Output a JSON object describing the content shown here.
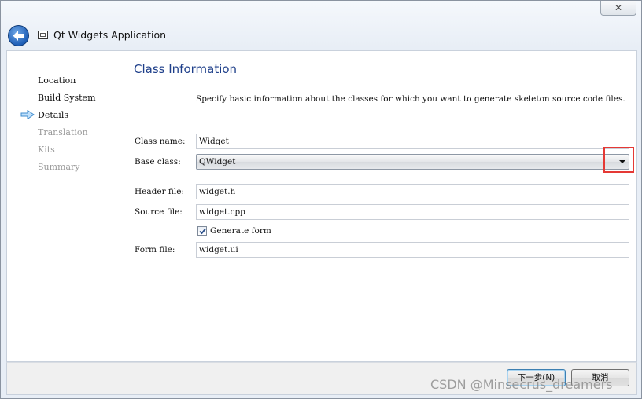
{
  "window": {
    "close_glyph": "✕",
    "title": "Qt Widgets Application"
  },
  "sidebar": {
    "items": [
      {
        "label": "Location",
        "state": "done"
      },
      {
        "label": "Build System",
        "state": "done"
      },
      {
        "label": "Details",
        "state": "current"
      },
      {
        "label": "Translation",
        "state": "todo"
      },
      {
        "label": "Kits",
        "state": "todo"
      },
      {
        "label": "Summary",
        "state": "todo"
      }
    ]
  },
  "page": {
    "title": "Class Information",
    "description": "Specify basic information about the classes for which you want to generate skeleton source code files."
  },
  "form": {
    "class_name_label": "Class name:",
    "class_name_value": "Widget",
    "base_class_label": "Base class:",
    "base_class_value": "QWidget",
    "header_file_label": "Header file:",
    "header_file_value": "widget.h",
    "source_file_label": "Source file:",
    "source_file_value": "widget.cpp",
    "generate_form_label": "Generate form",
    "generate_form_checked": true,
    "form_file_label": "Form file:",
    "form_file_value": "widget.ui"
  },
  "footer": {
    "next_label": "下一步(N)",
    "cancel_label": "取消"
  },
  "watermark": "CSDN @Minsecrus_dreamers",
  "colors": {
    "title_blue": "#1e3f8a",
    "highlight_red": "#e53935",
    "back_button_blue": "#1e5eb6"
  },
  "icons": {
    "back": "back-arrow-icon",
    "current_step": "current-step-arrow-icon",
    "dropdown": "chevron-down-icon",
    "check": "checkmark-icon",
    "app": "window-icon"
  }
}
